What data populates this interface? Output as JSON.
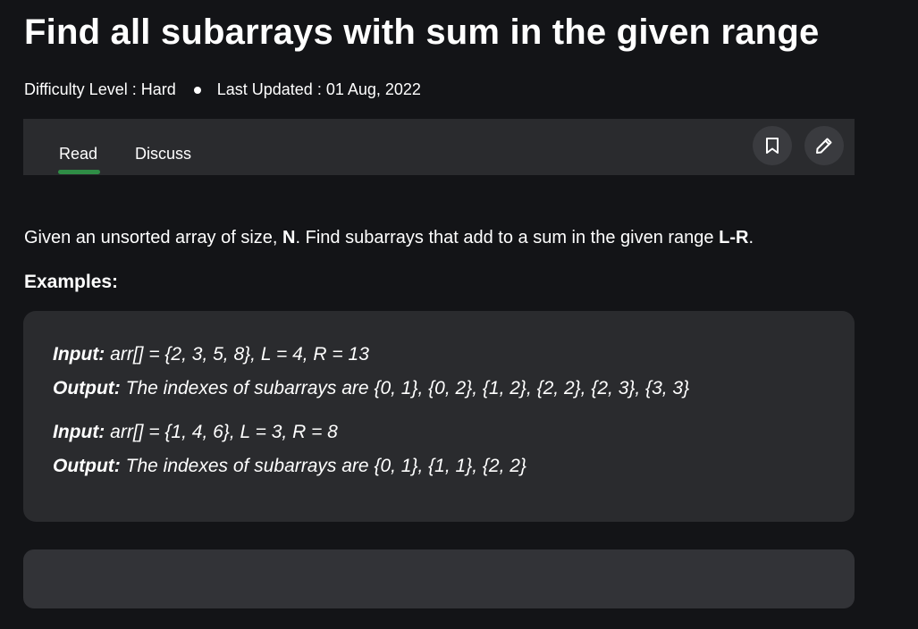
{
  "article": {
    "title": "Find all subarrays with sum in the given range",
    "difficulty": "Difficulty Level : Hard",
    "last_updated": "Last Updated : 01 Aug, 2022"
  },
  "tabs": {
    "read": "Read",
    "discuss": "Discuss",
    "active": "Read",
    "accent_color": "#2f8d46"
  },
  "actions": {
    "bookmark_icon": "bookmark-icon",
    "edit_icon": "pencil-icon"
  },
  "content": {
    "desc_part1": "Given an unsorted array of size, ",
    "desc_n": "N",
    "desc_part2": ". Find subarrays that add to a sum in the given range ",
    "desc_lr": "L-R",
    "desc_part3": ".",
    "examples_heading": "Examples:"
  },
  "examples": [
    {
      "input_label": "Input:",
      "input_text": " arr[] = {2, 3, 5, 8}, L = 4, R = 13",
      "output_label": "Output:",
      "output_text": " The indexes of subarrays are {0, 1}, {0, 2}, {1, 2}, {2, 2}, {2, 3}, {3, 3}"
    },
    {
      "input_label": "Input:",
      "input_text": " arr[] = {1, 4, 6}, L = 3, R = 8",
      "output_label": "Output:",
      "output_text": " The indexes of subarrays are {0, 1}, {1, 1}, {2, 2}"
    }
  ]
}
